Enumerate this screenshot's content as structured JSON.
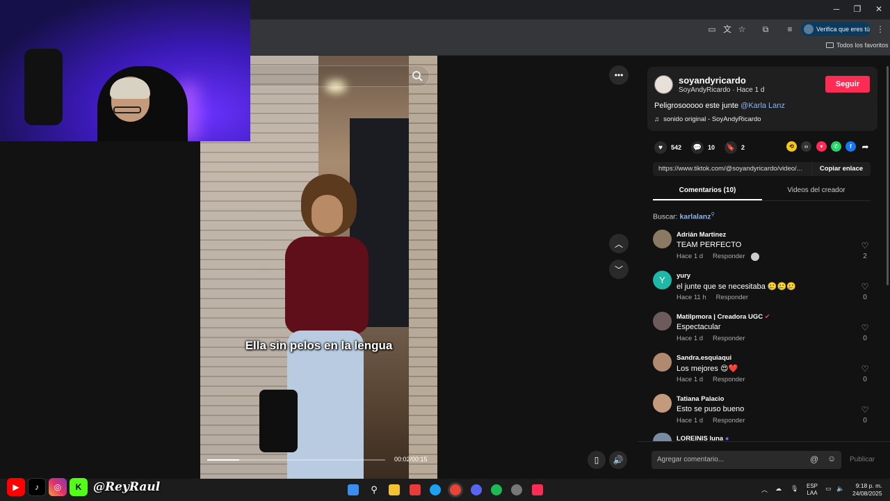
{
  "browser": {
    "window_controls": {
      "minimize": "─",
      "maximize": "❐",
      "close": "✕"
    },
    "verify_label": "Verifica que eres tú",
    "bookmarks_folder": "Todos los favoritos"
  },
  "video": {
    "caption": "Ella sin pelos en la lengua",
    "time": "00:02/00:15",
    "progress": 0.18
  },
  "creator": {
    "username": "soyandyricardo",
    "subtitle": "SoyAndyRicardo · Hace 1 d",
    "follow_label": "Seguir",
    "description_text": "Peligrosooooo este junte ",
    "description_mention": "@Karla Lanz",
    "sound": "sonido original - SoyAndyRicardo"
  },
  "stats": {
    "likes": "542",
    "comments": "10",
    "saves": "2"
  },
  "share": {
    "link": "https://www.tiktok.com/@soyandyricardo/video/...",
    "copy_label": "Copiar enlace"
  },
  "tabs": {
    "comments": "Comentarios (10)",
    "creator_videos": "Videos del creador"
  },
  "search": {
    "label": "Buscar: ",
    "keyword": "karlalanz"
  },
  "comments": [
    {
      "name": "Adrián Martinez",
      "text": "TEAM PERFECTO",
      "time": "Hace 1 d",
      "reply": "Responder",
      "likes": "2",
      "avatar_color": "#8a7a64"
    },
    {
      "name": "yury",
      "text": "el junte que se necesitaba 🥲🥲🥲",
      "time": "Hace 11 h",
      "reply": "Responder",
      "likes": "0",
      "avatar_color": "#1fb7a6",
      "initial": "Y"
    },
    {
      "name": "Matilpmora | Creadora UGC",
      "text": "Espectacular",
      "time": "Hace 1 d",
      "reply": "Responder",
      "likes": "0",
      "avatar_color": "#6d5a5a"
    },
    {
      "name": "Sandra.esquiaqui",
      "text": "Los mejores 😍❤️",
      "time": "Hace 1 d",
      "reply": "Responder",
      "likes": "0",
      "avatar_color": "#b08a70"
    },
    {
      "name": "Tatiana Palacio",
      "text": "Esto se puso bueno",
      "time": "Hace 1 d",
      "reply": "Responder",
      "likes": "0",
      "avatar_color": "#c49a7c"
    },
    {
      "name": "LOREINIS luna",
      "text": "",
      "time": "",
      "reply": "",
      "likes": "",
      "avatar_color": "#7a8aa0"
    }
  ],
  "comment_input": {
    "placeholder": "Agregar comentario...",
    "post_label": "Publicar"
  },
  "overlay": {
    "handle": "@ReyRaul",
    "socials": [
      "youtube-icon",
      "tiktok-icon",
      "instagram-icon",
      "kick-icon"
    ]
  },
  "taskbar": {
    "lang_top": "ESP",
    "lang_bottom": "LAA",
    "time": "9:18 p. m.",
    "date": "24/08/2025"
  },
  "colors": {
    "follow": "#fe2c55",
    "mention": "#8ab4f8",
    "background": "#121212"
  }
}
